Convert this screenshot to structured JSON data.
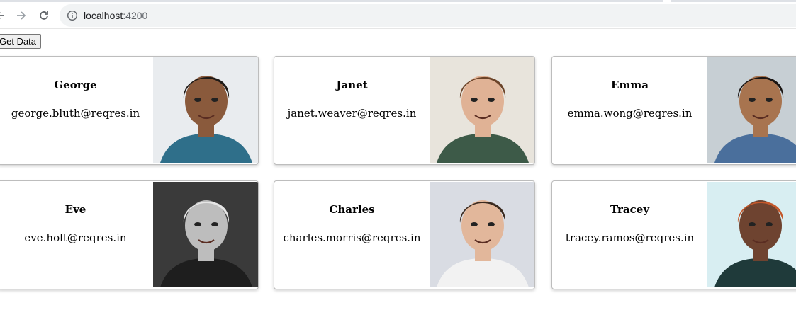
{
  "browser": {
    "url_host": "localhost",
    "url_port": ":4200"
  },
  "page": {
    "get_data_label": "Get Data"
  },
  "users": [
    {
      "name": "George",
      "email": "george.bluth@reqres.in",
      "photo_bg": "#e9ecef",
      "skin": "#8a5a3c",
      "hair": "#1f1a17",
      "shirt": "#2f6f8a"
    },
    {
      "name": "Janet",
      "email": "janet.weaver@reqres.in",
      "photo_bg": "#e8e4dc",
      "skin": "#e0b295",
      "hair": "#6b4328",
      "shirt": "#3d5a48"
    },
    {
      "name": "Emma",
      "email": "emma.wong@reqres.in",
      "photo_bg": "#c7cfd4",
      "skin": "#a8744f",
      "hair": "#1b1614",
      "shirt": "#4a6f9c"
    },
    {
      "name": "Eve",
      "email": "eve.holt@reqres.in",
      "photo_bg": "#3a3a3a",
      "skin": "#bdbdbd",
      "hair": "#e6e6e6",
      "shirt": "#1e1e1e"
    },
    {
      "name": "Charles",
      "email": "charles.morris@reqres.in",
      "photo_bg": "#d9dce3",
      "skin": "#e2b79b",
      "hair": "#3a2a20",
      "shirt": "#f2f2f2"
    },
    {
      "name": "Tracey",
      "email": "tracey.ramos@reqres.in",
      "photo_bg": "#d8eef2",
      "skin": "#6e4330",
      "hair": "#c4582b",
      "shirt": "#1f3a3a"
    }
  ]
}
